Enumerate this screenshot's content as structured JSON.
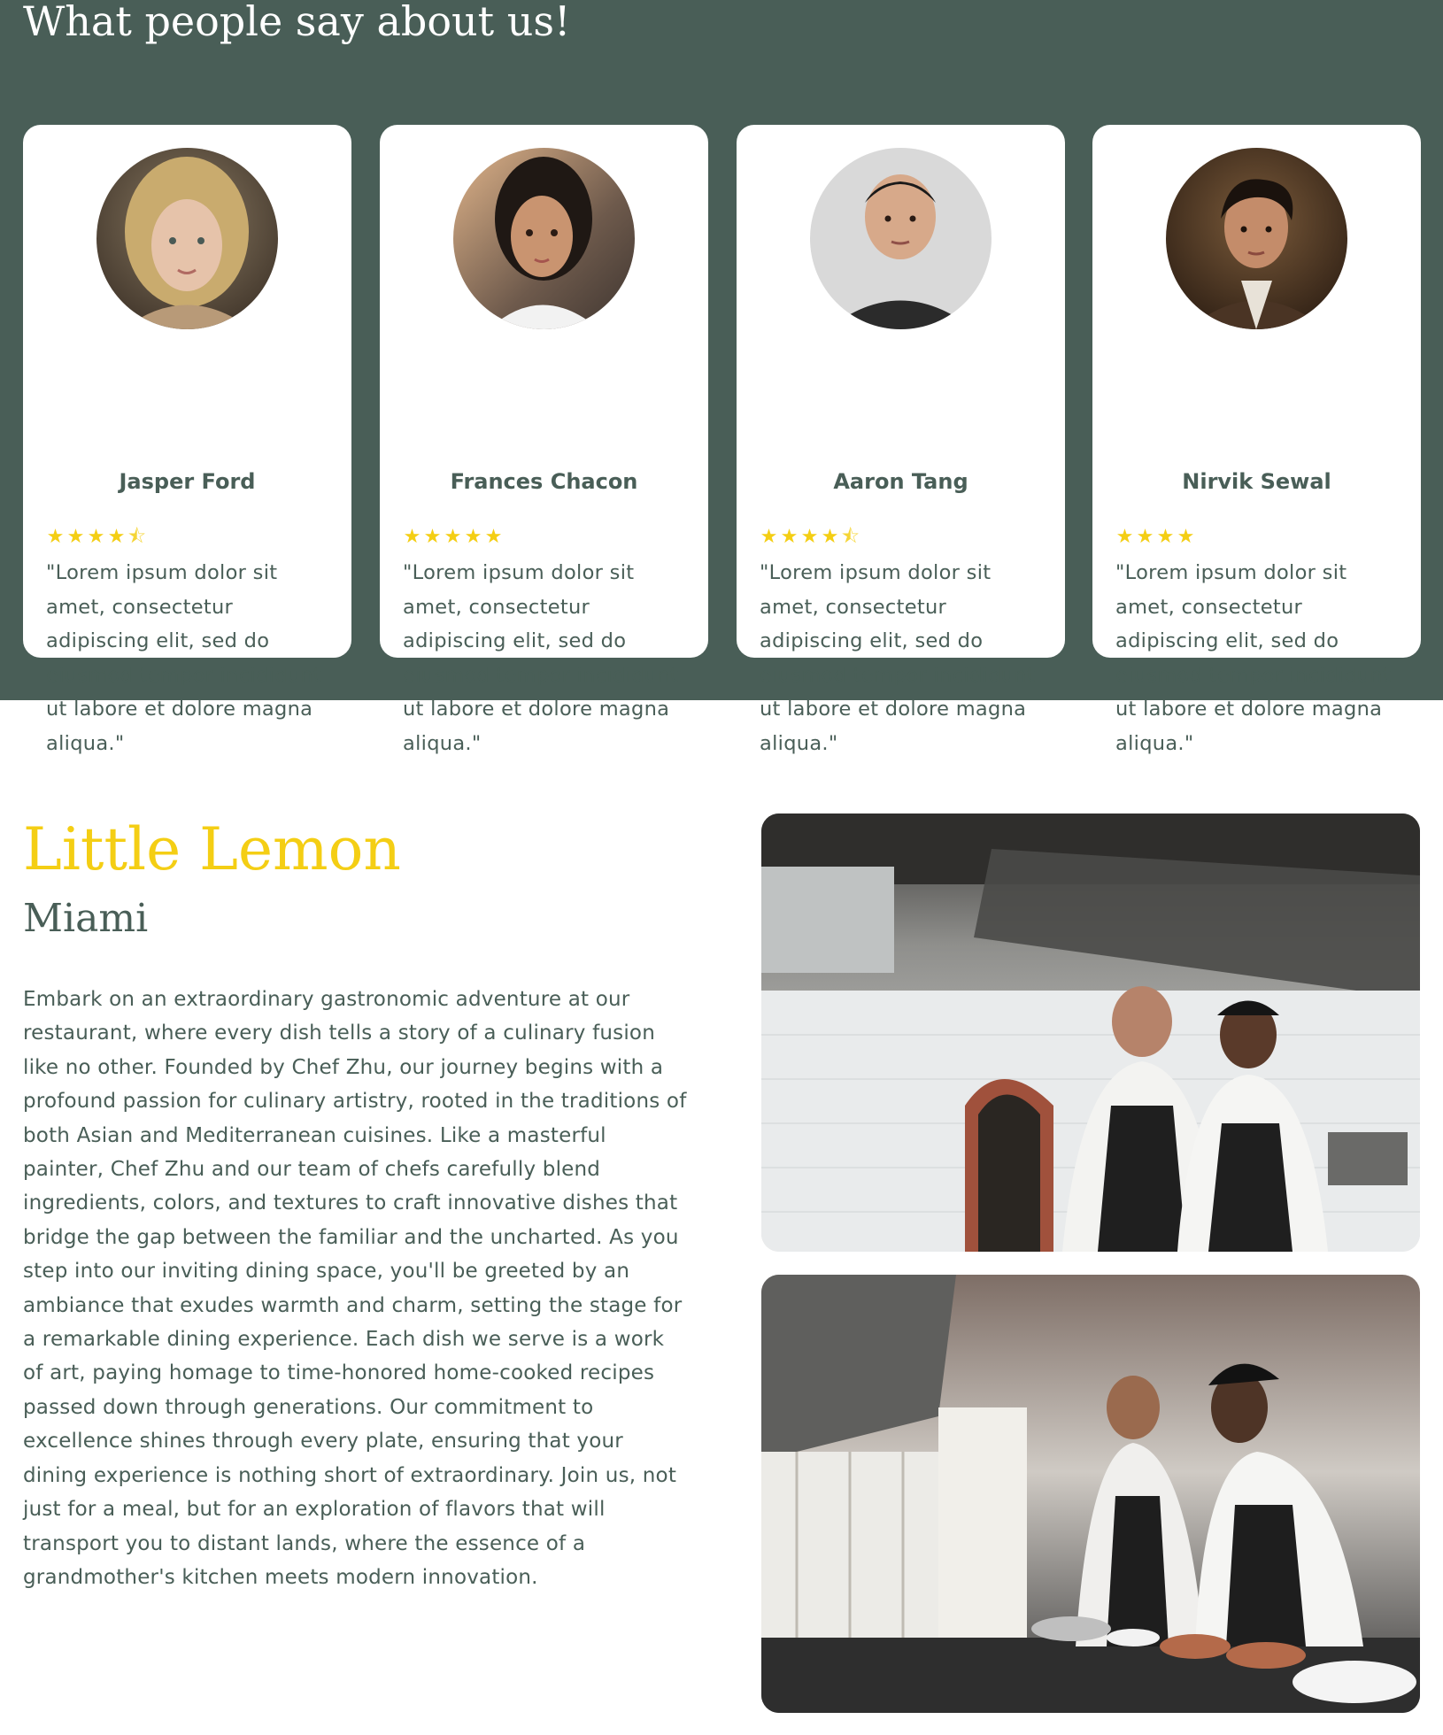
{
  "testimonials": {
    "title": "What people say about us!",
    "reviews": [
      {
        "name": "Jasper Ford",
        "rating": 4.5,
        "stars_display": "★★★★⯪",
        "quote": "\"Lorem ipsum dolor sit amet, consectetur adipiscing elit, sed do eiusmod tempor incididunt ut labore et dolore magna aliqua.\""
      },
      {
        "name": "Frances Chacon",
        "rating": 5,
        "stars_display": "★★★★★",
        "quote": "\"Lorem ipsum dolor sit amet, consectetur adipiscing elit, sed do eiusmod tempor incididunt ut labore et dolore magna aliqua.\""
      },
      {
        "name": "Aaron Tang",
        "rating": 4.5,
        "stars_display": "★★★★⯪",
        "quote": "\"Lorem ipsum dolor sit amet, consectetur adipiscing elit, sed do eiusmod tempor incididunt ut labore et dolore magna aliqua.\""
      },
      {
        "name": "Nirvik Sewal",
        "rating": 4,
        "stars_display": "★★★★",
        "quote": "\"Lorem ipsum dolor sit amet, consectetur adipiscing elit, sed do eiusmod tempor incididunt ut labore et dolore magna aliqua.\""
      }
    ]
  },
  "about": {
    "title": "Little Lemon",
    "subtitle": "Miami",
    "body": "Embark on an extraordinary gastronomic adventure at our restaurant, where every dish tells a story of a culinary fusion like no other. Founded by Chef Zhu, our journey begins with a profound passion for culinary artistry, rooted in the traditions of both Asian and Mediterranean cuisines. Like a masterful painter, Chef Zhu and our team of chefs carefully blend ingredients, colors, and textures to craft innovative dishes that bridge the gap between the familiar and the uncharted. As you step into our inviting dining space, you'll be greeted by an ambiance that exudes warmth and charm, setting the stage for a remarkable dining experience. Each dish we serve is a work of art, paying homage to time-honored home-cooked recipes passed down through generations. Our commitment to excellence shines through every plate, ensuring that your dining experience is nothing short of extraordinary. Join us, not just for a meal, but for an exploration of flavors that will transport you to distant lands, where the essence of a grandmother's kitchen meets modern innovation."
  },
  "colors": {
    "primary_green": "#495e57",
    "primary_yellow": "#f4ce14",
    "card_bg": "#ffffff"
  },
  "icons": {
    "star": "star-icon",
    "half_star": "half-star-icon"
  }
}
